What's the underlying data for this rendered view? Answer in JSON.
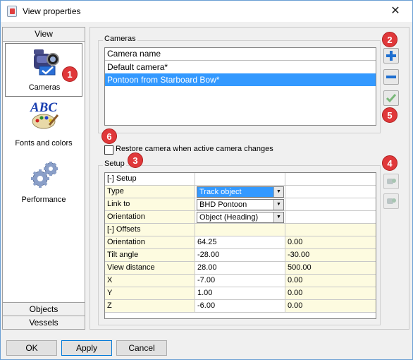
{
  "window": {
    "title": "View properties",
    "close_symbol": "✕"
  },
  "nav": {
    "header": "View",
    "items": [
      {
        "label": "Cameras",
        "icon": "camera-icon",
        "selected": true
      },
      {
        "label": "Fonts and colors",
        "icon": "abc-palette-icon",
        "selected": false
      },
      {
        "label": "Performance",
        "icon": "gears-icon",
        "selected": false
      }
    ],
    "footer_items": [
      "Objects",
      "Vessels"
    ]
  },
  "badges": [
    "1",
    "2",
    "3",
    "4",
    "5",
    "6"
  ],
  "cameras": {
    "group_label": "Cameras",
    "column_header": "Camera name",
    "rows": [
      {
        "name": "Default camera*",
        "selected": false
      },
      {
        "name": "Pontoon from Starboard Bow*",
        "selected": true
      }
    ],
    "buttons": {
      "add_icon": "plus-icon",
      "remove_icon": "minus-icon",
      "apply_icon": "check-icon"
    }
  },
  "restore_checkbox": {
    "label": "Restore camera when active camera changes",
    "checked": false
  },
  "setup": {
    "group_label": "Setup",
    "rows": [
      {
        "c1": "[-] Setup",
        "c2": "",
        "c3": "",
        "kind": "section"
      },
      {
        "c1": "Type",
        "c2": "Track object",
        "c3": "",
        "kind": "combo-selected"
      },
      {
        "c1": "Link to",
        "c2": "BHD Pontoon",
        "c3": "",
        "kind": "combo"
      },
      {
        "c1": "Orientation",
        "c2": "Object (Heading)",
        "c3": "",
        "kind": "combo"
      },
      {
        "c1": "[-] Offsets",
        "c2": "",
        "c3": "",
        "kind": "section"
      },
      {
        "c1": "Orientation",
        "c2": "64.25",
        "c3": "0.00",
        "kind": "value"
      },
      {
        "c1": "Tilt angle",
        "c2": "-28.00",
        "c3": "-30.00",
        "kind": "value"
      },
      {
        "c1": "View distance",
        "c2": "28.00",
        "c3": "500.00",
        "kind": "value"
      },
      {
        "c1": "X",
        "c2": "-7.00",
        "c3": "0.00",
        "kind": "value"
      },
      {
        "c1": "Y",
        "c2": "1.00",
        "c3": "0.00",
        "kind": "value"
      },
      {
        "c1": "Z",
        "c2": "-6.00",
        "c3": "0.00",
        "kind": "value"
      }
    ],
    "side_buttons": [
      "camera-copy-icon",
      "camera-paste-icon"
    ]
  },
  "buttons": {
    "ok": "OK",
    "apply": "Apply",
    "cancel": "Cancel"
  },
  "colors": {
    "selection": "#3399ff",
    "badge": "#e0383a",
    "grid_yellow": "#fdfbe0"
  }
}
